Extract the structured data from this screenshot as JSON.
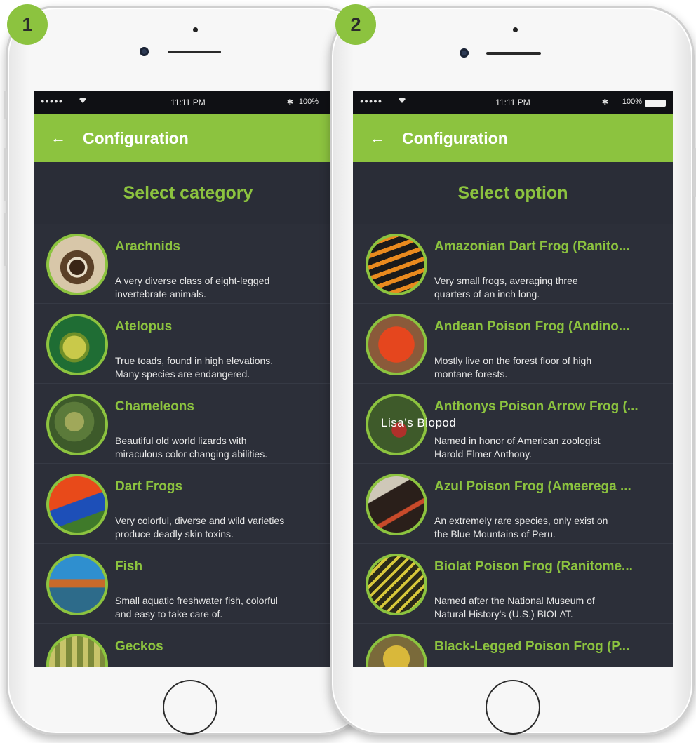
{
  "badges": {
    "step1": "1",
    "step2": "2"
  },
  "status": {
    "signal": "●●●●●",
    "time": "11:11 PM",
    "battery_left": "100%",
    "battery_right": "100%"
  },
  "screen1": {
    "header_title": "Configuration",
    "section_title": "Select category",
    "items": [
      {
        "title": "Arachnids",
        "desc1": "A very diverse class of eight-legged",
        "desc2": "invertebrate animals."
      },
      {
        "title": "Atelopus",
        "desc1": "True toads, found in high elevations.",
        "desc2": "Many species are endangered."
      },
      {
        "title": "Chameleons",
        "desc1": "Beautiful old world lizards with",
        "desc2": "miraculous color changing abilities."
      },
      {
        "title": "Dart Frogs",
        "desc1": "Very colorful, diverse and wild varieties",
        "desc2": "produce deadly skin toxins."
      },
      {
        "title": "Fish",
        "desc1": "Small aquatic freshwater fish, colorful",
        "desc2": "and easy to take care of."
      },
      {
        "title": "Geckos",
        "desc1": "",
        "desc2": ""
      }
    ]
  },
  "screen2": {
    "header_title": "Configuration",
    "section_title": "Select option",
    "items": [
      {
        "title": "Amazonian Dart Frog (Ranito...",
        "desc1": "Very small frogs, averaging three",
        "desc2": "quarters of an inch long."
      },
      {
        "title": "Andean Poison Frog  (Andino...",
        "desc1": "Mostly live on the forest floor of high",
        "desc2": "montane forests."
      },
      {
        "title": "Anthonys Poison Arrow Frog (...",
        "desc1": "Named in honor of American zoologist",
        "desc2": "Harold Elmer Anthony."
      },
      {
        "title": "Azul Poison Frog (Ameerega ...",
        "desc1": "An extremely rare species, only exist on",
        "desc2": "the Blue Mountains of Peru."
      },
      {
        "title": "Biolat Poison Frog (Ranitome...",
        "desc1": "Named after the National Museum of",
        "desc2": "Natural History's (U.S.) BIOLAT."
      },
      {
        "title": "Black-Legged Poison Frog (P...",
        "desc1": "",
        "desc2": ""
      }
    ]
  },
  "watermark": "Lisa’s Biopod",
  "colors": {
    "accent": "#8cc33f",
    "background": "#2a2d37",
    "statusbar": "#0f1014"
  }
}
